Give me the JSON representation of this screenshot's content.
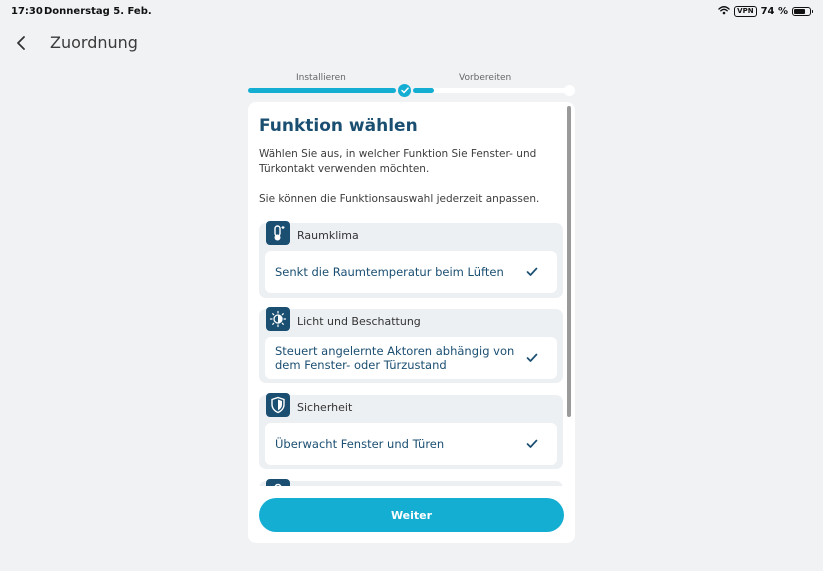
{
  "status_bar": {
    "time": "17:30",
    "date": "Donnerstag 5. Feb.",
    "vpn": "VPN",
    "battery": "74 %",
    "battery_level": 0.74
  },
  "header": {
    "title": "Zuordnung"
  },
  "stepper": {
    "steps": [
      {
        "label": "Installieren",
        "state": "completed"
      },
      {
        "label": "Vorbereiten",
        "state": "active"
      }
    ]
  },
  "card": {
    "title": "Funktion wählen",
    "description": "Wählen Sie aus, in welcher Funktion Sie Fenster- und Türkontakt verwenden möchten.",
    "hint": "Sie können die Funktionsauswahl jederzeit anpassen.",
    "groups": [
      {
        "icon": "thermometer-icon",
        "title": "Raumklima",
        "option": "Senkt die Raumtemperatur beim Lüften",
        "checked": true
      },
      {
        "icon": "light-shade-icon",
        "title": "Licht und Beschattung",
        "option": "Steuert angelernte Aktoren abhängig von dem Fenster- oder Türzustand",
        "checked": true
      },
      {
        "icon": "shield-icon",
        "title": "Sicherheit",
        "option": "Überwacht Fenster und Türen",
        "checked": true
      },
      {
        "icon": "lock-icon"
      }
    ]
  },
  "footer": {
    "continue_label": "Weiter"
  },
  "colors": {
    "accent": "#15aed3",
    "brand_dark": "#1b4f72",
    "background": "#f1f2f4"
  }
}
